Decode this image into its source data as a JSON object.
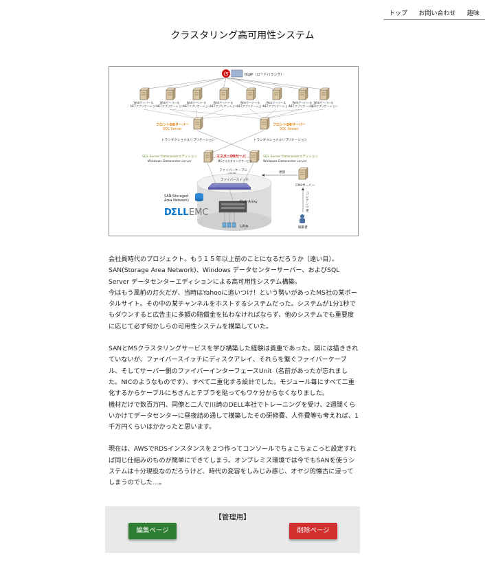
{
  "nav": {
    "items": [
      "トップ",
      "お問い合わせ",
      "趣味"
    ]
  },
  "page": {
    "title": "クラスタリング高可用性システム"
  },
  "diagram": {
    "bigip_label": "BigIP（ロードバランサ）",
    "web_server_label": "Webサーバー＆",
    "web_server_sub": ".NETアプリケーション",
    "front_db_label": "フロントDBサーバー",
    "front_db_sub": "SQL Server",
    "transactional_replication": "トランザクショナルリプリケーション",
    "sql_datacenter": "SQL Server Datacenterエディション",
    "windows_datacenter": "Windows Datacenter server",
    "master_db_label": "マスターDBサーバ",
    "ms_cluster": "MSクラスタリングサービス",
    "fiber_cable": "ファイバーケーブル",
    "fiber_cable_sub": "（高速）",
    "fiber_switch": "ファイバースイッチ",
    "san_label": "SAN(Storaged Area Network)",
    "disk_array": "Disk Array",
    "luns": "LUNs",
    "dell_emc": "D&LLEMC",
    "update_label": "更新",
    "cms_server": "CMSサーバー",
    "content_update": "コンテンツ更新",
    "editor_label": "編集者",
    "colors": {
      "accent_orange": "#e07b00",
      "accent_red": "#d01010",
      "dell_blue": "#0076ce",
      "emc_grey": "#6d6e71"
    }
  },
  "content": {
    "paragraphs": [
      "会社員時代のプロジェクト。もう１５年以上前のことになるだろうか（遠い目）。\nSAN(Storage Area Network)、Windows データセンターサーバー、およびSQL Server データセンターエディションによる高可用性システム構築。\n今はもう風前の灯火だが、当時はYahooに追いつけ！という勢いがあったMS社の某ポータルサイト。その中の某チャンネルをホストするシステムだった。システムが1分1秒でもダウンすると広告主に多額の賠償金を払わなければならず、他のシステムでも重要度に応じて必ず何かしらの可用性システムを構築していた。",
      "SANとMSクラスタリングサービスを学び構築した経験は貴重であった。図には描ききれていないが、ファイバースイッチにディスクアレイ、それらを繋ぐファイバーケーブル、そしてサーバー側のファイバーインターフェースUnit（名前があったが忘れました。NICのようなものです）、すべて二重化する設計でした。モジュール毎にすべて二重化するからケーブルにちきんとテプラを貼ってもワケ分からなくなりました。\n機材だけで数百万円、同僚と二人で川崎のDELL本社でトレーニングを受け、2週間くらいかけてデータセンターに昼夜詰め通して構築したその研修費、人件費等も考えれば、1千万円くらいはかかったと思います。",
      "現在は、AWSでRDSインスタンスを２つ作ってコンソールでちょこちょこっと設定すれば同じ仕組みのものが簡単にできてしまう。オンプレミス環境では今でもSANを使うシステムは十分現役なのだろうけど、時代の変容をしみじみ感じ、オヤジ的懐古に浸ってしまうのでした…。"
    ]
  },
  "admin": {
    "title": "【管理用】",
    "edit_label": "編集ページ",
    "delete_label": "削除ページ",
    "colors": {
      "edit": "#2e7d32",
      "delete": "#d32f2f",
      "panel": "#e9e9e9"
    }
  }
}
